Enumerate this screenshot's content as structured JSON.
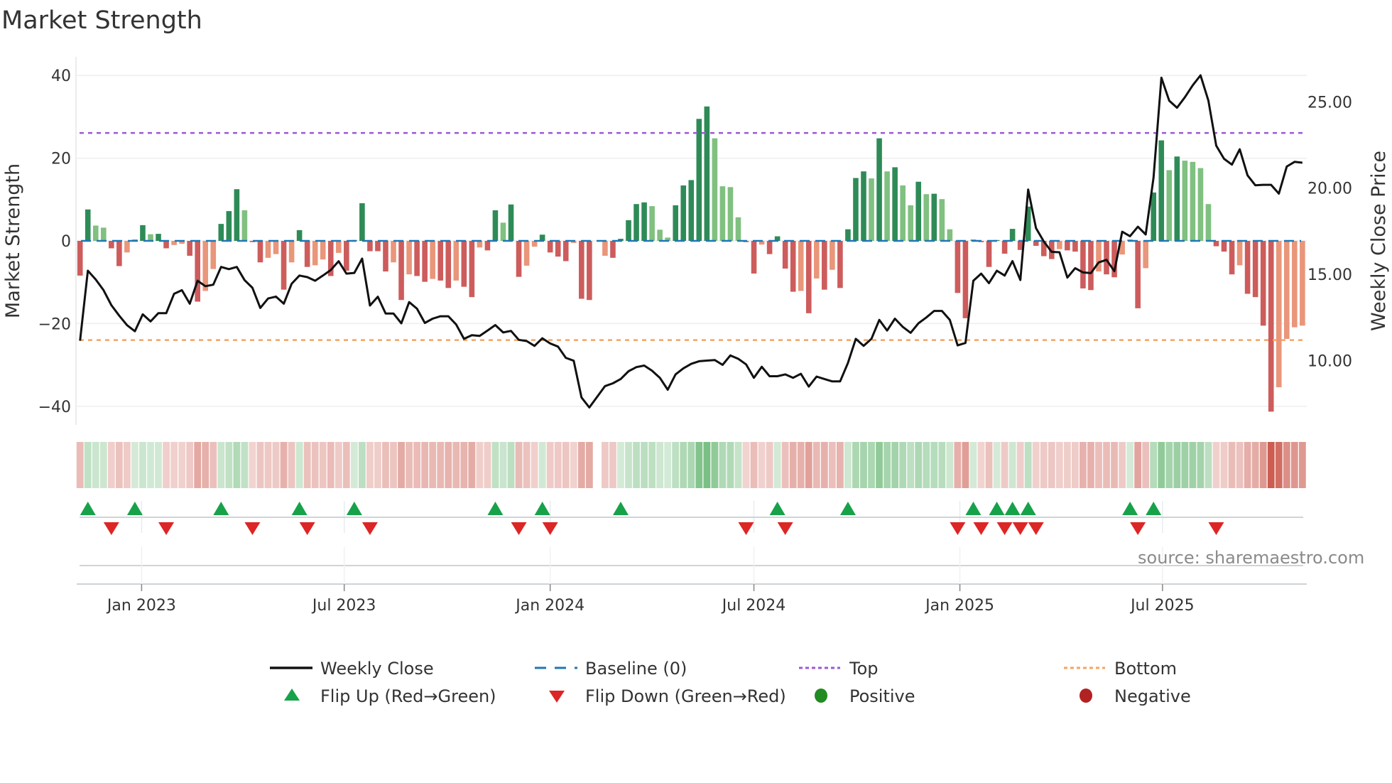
{
  "chart_data": {
    "type": "bar+line",
    "title": "Market Strength",
    "source": "source: sharemaestro.com",
    "ylabel_left": "Market Strength",
    "ylabel_right": "Weekly Close Price",
    "ylim_left": [
      -44.5,
      44.5
    ],
    "ylim_right": [
      6.27,
      27.61
    ],
    "yticks_left": [
      {
        "v": 40,
        "label": "40"
      },
      {
        "v": 20,
        "label": "20"
      },
      {
        "v": 0,
        "label": "0"
      },
      {
        "v": -20,
        "label": "−20"
      },
      {
        "v": -40,
        "label": "−40"
      }
    ],
    "yticks_right": [
      {
        "v": 25,
        "label": "25.00"
      },
      {
        "v": 20,
        "label": "20.00"
      },
      {
        "v": 15,
        "label": "15.00"
      },
      {
        "v": 10,
        "label": "10.00"
      }
    ],
    "xticks": [
      {
        "date": "2023-01-01",
        "label": "Jan 2023"
      },
      {
        "date": "2023-07-01",
        "label": "Jul 2023"
      },
      {
        "date": "2024-01-01",
        "label": "Jan 2024"
      },
      {
        "date": "2024-07-01",
        "label": "Jul 2024"
      },
      {
        "date": "2025-01-01",
        "label": "Jan 2025"
      },
      {
        "date": "2025-07-01",
        "label": "Jul 2025"
      }
    ],
    "grid": true,
    "legend_placement": "bottom",
    "top_level": 26.1,
    "bottom_level": -24.0,
    "baseline": 0,
    "colors": {
      "positive_strong": "#2e8b57",
      "positive_weak": "#80c080",
      "negative_strong": "#cd5c5c",
      "negative_weak": "#e9967a",
      "weekly_close": "#111111",
      "baseline": "#1f77b4",
      "top": "#9b59d6",
      "bottom": "#f4a460",
      "flip_up": "#17a24a",
      "flip_down": "#dc2626",
      "positive_dot": "#228b22",
      "negative_dot": "#b22222",
      "strip_positive": "#3fa34d",
      "strip_negative": "#c0392b"
    },
    "dates": [
      "2022-11-07",
      "2022-11-14",
      "2022-11-21",
      "2022-11-28",
      "2022-12-05",
      "2022-12-12",
      "2022-12-19",
      "2022-12-26",
      "2023-01-02",
      "2023-01-09",
      "2023-01-16",
      "2023-01-23",
      "2023-01-30",
      "2023-02-06",
      "2023-02-13",
      "2023-02-20",
      "2023-02-27",
      "2023-03-06",
      "2023-03-13",
      "2023-03-20",
      "2023-03-27",
      "2023-04-03",
      "2023-04-10",
      "2023-04-17",
      "2023-04-24",
      "2023-05-01",
      "2023-05-08",
      "2023-05-15",
      "2023-05-22",
      "2023-05-29",
      "2023-06-05",
      "2023-06-12",
      "2023-06-19",
      "2023-06-26",
      "2023-07-03",
      "2023-07-10",
      "2023-07-17",
      "2023-07-24",
      "2023-07-31",
      "2023-08-07",
      "2023-08-14",
      "2023-08-21",
      "2023-08-28",
      "2023-09-04",
      "2023-09-11",
      "2023-09-18",
      "2023-09-25",
      "2023-10-02",
      "2023-10-09",
      "2023-10-16",
      "2023-10-23",
      "2023-10-30",
      "2023-11-06",
      "2023-11-13",
      "2023-11-20",
      "2023-11-27",
      "2023-12-04",
      "2023-12-11",
      "2023-12-18",
      "2023-12-25",
      "2024-01-01",
      "2024-01-08",
      "2024-01-15",
      "2024-01-22",
      "2024-01-29",
      "2024-02-05",
      "2024-02-12",
      "2024-02-19",
      "2024-02-26",
      "2024-03-04",
      "2024-03-11",
      "2024-03-18",
      "2024-03-25",
      "2024-04-01",
      "2024-04-08",
      "2024-04-15",
      "2024-04-22",
      "2024-04-29",
      "2024-05-06",
      "2024-05-13",
      "2024-05-20",
      "2024-05-27",
      "2024-06-03",
      "2024-06-10",
      "2024-06-17",
      "2024-06-24",
      "2024-07-01",
      "2024-07-08",
      "2024-07-15",
      "2024-07-22",
      "2024-07-29",
      "2024-08-05",
      "2024-08-12",
      "2024-08-19",
      "2024-08-26",
      "2024-09-02",
      "2024-09-09",
      "2024-09-16",
      "2024-09-23",
      "2024-09-30",
      "2024-10-07",
      "2024-10-14",
      "2024-10-21",
      "2024-10-28",
      "2024-11-04",
      "2024-11-11",
      "2024-11-18",
      "2024-11-25",
      "2024-12-02",
      "2024-12-09",
      "2024-12-16",
      "2024-12-23",
      "2024-12-30",
      "2025-01-06",
      "2025-01-13",
      "2025-01-20",
      "2025-01-27",
      "2025-02-03",
      "2025-02-10",
      "2025-02-17",
      "2025-02-24",
      "2025-03-03",
      "2025-03-10",
      "2025-03-17",
      "2025-03-24",
      "2025-03-31",
      "2025-04-07",
      "2025-04-14",
      "2025-04-21",
      "2025-04-28",
      "2025-05-05",
      "2025-05-12",
      "2025-05-19",
      "2025-05-26",
      "2025-06-02",
      "2025-06-09",
      "2025-06-16",
      "2025-06-23",
      "2025-06-30",
      "2025-07-07",
      "2025-07-14",
      "2025-07-21",
      "2025-07-28",
      "2025-08-04",
      "2025-08-11",
      "2025-08-18",
      "2025-08-25",
      "2025-09-01",
      "2025-09-08",
      "2025-09-15",
      "2025-09-22",
      "2025-09-29",
      "2025-10-06",
      "2025-10-13",
      "2025-10-20",
      "2025-10-27",
      "2025-11-03"
    ],
    "strength": [
      -8.4,
      7.6,
      3.7,
      3.2,
      -1.8,
      -6.1,
      -2.8,
      0.3,
      3.8,
      1.6,
      1.7,
      -1.8,
      -1.0,
      -0.7,
      -3.6,
      -14.7,
      -12.1,
      -6.8,
      4.1,
      7.2,
      12.5,
      7.4,
      -0.3,
      -5.2,
      -4.1,
      -3.2,
      -11.8,
      -5.2,
      2.6,
      -6.3,
      -5.9,
      -4.5,
      -8.5,
      -2.9,
      -7.2,
      0.2,
      9.1,
      -2.5,
      -2.5,
      -7.4,
      -5.2,
      -14.3,
      -8.1,
      -8.5,
      -9.9,
      -9.2,
      -9.6,
      -11.4,
      -9.6,
      -11.1,
      -13.6,
      -1.6,
      -2.3,
      7.4,
      4.4,
      8.8,
      -8.7,
      -6.0,
      -1.4,
      1.5,
      -2.8,
      -3.8,
      -4.9,
      -0.5,
      -14.0,
      -14.3,
      0,
      -3.6,
      -4.1,
      0.5,
      5.0,
      8.9,
      9.3,
      8.4,
      2.7,
      0.8,
      8.6,
      13.4,
      14.7,
      29.5,
      32.5,
      24.8,
      13.2,
      13.0,
      5.7,
      -0.3,
      -7.9,
      -0.9,
      -3.2,
      1.1,
      -6.7,
      -12.3,
      -12.1,
      -17.5,
      -9.1,
      -11.8,
      -7.0,
      -11.4,
      2.8,
      15.2,
      16.8,
      15.1,
      24.8,
      16.8,
      17.8,
      13.4,
      8.6,
      14.3,
      11.3,
      11.4,
      10.1,
      2.8,
      -12.6,
      -18.7,
      0.3,
      -0.3,
      -6.3,
      0.2,
      -3.1,
      2.9,
      -2.2,
      8.3,
      -1.2,
      -3.7,
      -4.4,
      -2.0,
      -2.3,
      -2.6,
      -11.5,
      -11.9,
      -7.4,
      -8.1,
      -8.8,
      -3.3,
      0.3,
      -16.3,
      -6.6,
      11.7,
      24.3,
      17.1,
      20.4,
      19.4,
      19.1,
      17.6,
      8.9,
      -1.3,
      -2.6,
      -8.1,
      -5.9,
      -12.8,
      -13.6,
      -20.5,
      -41.3,
      -35.4,
      -23.7,
      -20.9,
      -20.5
    ],
    "weekly_close": [
      11.15,
      15.21,
      14.7,
      14.08,
      13.21,
      12.6,
      12.05,
      11.7,
      12.68,
      12.27,
      12.75,
      12.75,
      13.87,
      14.08,
      13.3,
      14.63,
      14.31,
      14.4,
      15.43,
      15.3,
      15.43,
      14.66,
      14.22,
      13.05,
      13.6,
      13.71,
      13.3,
      14.45,
      14.93,
      14.84,
      14.63,
      14.93,
      15.25,
      15.76,
      15.04,
      15.08,
      15.91,
      13.19,
      13.7,
      12.73,
      12.73,
      12.16,
      13.39,
      13.01,
      12.18,
      12.43,
      12.57,
      12.57,
      12.09,
      11.26,
      11.47,
      11.43,
      11.74,
      12.06,
      11.63,
      11.72,
      11.2,
      11.13,
      10.85,
      11.29,
      10.99,
      10.81,
      10.16,
      9.99,
      7.86,
      7.28,
      7.9,
      8.52,
      8.68,
      8.93,
      9.38,
      9.62,
      9.71,
      9.41,
      9.0,
      8.31,
      9.2,
      9.55,
      9.81,
      9.96,
      10.0,
      10.03,
      9.75,
      10.3,
      10.1,
      9.78,
      9.0,
      9.64,
      9.09,
      9.09,
      9.2,
      9.0,
      9.23,
      8.49,
      9.07,
      8.93,
      8.79,
      8.79,
      9.86,
      11.26,
      10.85,
      11.26,
      12.36,
      11.74,
      12.43,
      11.95,
      11.61,
      12.16,
      12.5,
      12.88,
      12.88,
      12.36,
      10.88,
      11.02,
      14.63,
      15.04,
      14.49,
      15.21,
      14.93,
      15.77,
      14.67,
      19.92,
      17.68,
      16.9,
      16.3,
      16.28,
      14.81,
      15.36,
      15.11,
      15.07,
      15.69,
      15.84,
      15.18,
      17.47,
      17.21,
      17.76,
      17.31,
      20.6,
      26.4,
      25.07,
      24.66,
      25.27,
      25.96,
      26.54,
      25.07,
      22.46,
      21.7,
      21.36,
      22.25,
      20.74,
      20.16,
      20.19,
      20.19,
      19.68,
      21.25,
      21.52,
      21.47
    ],
    "flips_up": [
      "2022-11-14",
      "2022-12-26",
      "2023-03-13",
      "2023-05-22",
      "2023-07-10",
      "2023-11-13",
      "2023-12-25",
      "2024-03-04",
      "2024-07-22",
      "2024-09-23",
      "2025-01-13",
      "2025-02-03",
      "2025-02-17",
      "2025-03-03",
      "2025-06-02",
      "2025-06-23"
    ],
    "flips_down": [
      "2022-12-05",
      "2023-01-23",
      "2023-04-10",
      "2023-05-29",
      "2023-07-24",
      "2023-12-04",
      "2024-01-01",
      "2024-06-24",
      "2024-07-29",
      "2024-12-30",
      "2025-01-20",
      "2025-02-10",
      "2025-02-24",
      "2025-03-10",
      "2025-06-09",
      "2025-08-18"
    ],
    "legend": [
      {
        "label": "Weekly Close",
        "kind": "line"
      },
      {
        "label": "Baseline (0)",
        "kind": "dash"
      },
      {
        "label": "Top",
        "kind": "dot-purple"
      },
      {
        "label": "Bottom",
        "kind": "dot-orange"
      },
      {
        "label": "Flip Up (Red→Green)",
        "kind": "tri-up"
      },
      {
        "label": "Flip Down (Green→Red)",
        "kind": "tri-down"
      },
      {
        "label": "Positive",
        "kind": "dot-pos"
      },
      {
        "label": "Negative",
        "kind": "dot-neg"
      }
    ]
  }
}
